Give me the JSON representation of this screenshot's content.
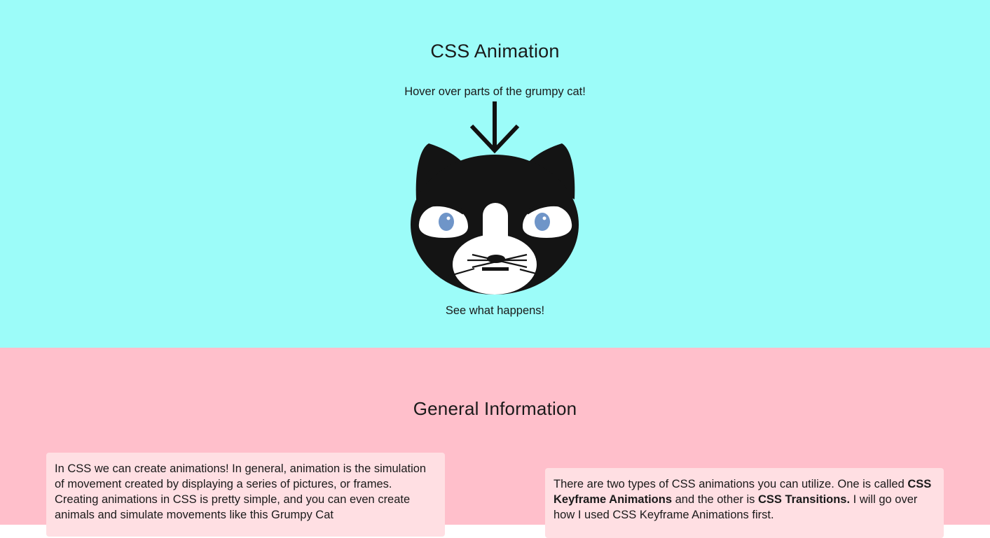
{
  "hero": {
    "title": "CSS Animation",
    "subtitle": "Hover over parts of the grumpy cat!",
    "caption": "See what happens!",
    "background": "#9cfcf9"
  },
  "cat": {
    "icon": "grumpy-cat-icon",
    "fur_color": "#141414",
    "face_color": "#ffffff",
    "eye_color": "#6f95c8"
  },
  "info": {
    "title": "General Information",
    "background": "#ffbfcb",
    "card_background": "#ffdfe3",
    "left_card": {
      "text": "In CSS we can create animations! In general, animation is the simulation of movement created by displaying a series of pictures, or frames. Creating animations in CSS is pretty simple, and you can even create animals and simulate movements like this Grumpy Cat"
    },
    "right_card": {
      "text_1": "There are two types of CSS animations you can utilize. One is called ",
      "bold_1": "CSS Keyframe Animations",
      "text_2": " and the other is ",
      "bold_2": "CSS Transitions.",
      "text_3": " I will go over how I used CSS Keyframe Animations first."
    }
  }
}
